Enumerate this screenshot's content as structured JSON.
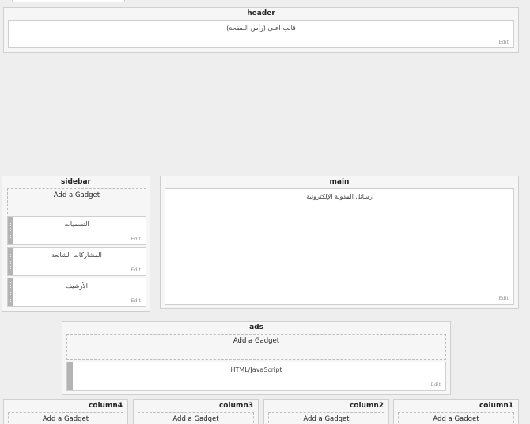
{
  "header": {
    "title": "header",
    "widget_title": "قالب اعلى (رأس الصفحة)",
    "edit": "Edit"
  },
  "sidebar": {
    "title": "sidebar",
    "add_gadget": "Add a Gadget",
    "widgets": [
      {
        "title": "التسميات",
        "edit": "Edit"
      },
      {
        "title": "المشاركات الشائعة",
        "edit": "Edit"
      },
      {
        "title": "الأرشيف",
        "edit": "Edit"
      }
    ]
  },
  "main": {
    "title": "main",
    "widget_title": "رسائل المدونة الإلكترونية",
    "edit": "Edit"
  },
  "ads": {
    "title": "ads",
    "add_gadget": "Add a Gadget",
    "widget_title": "HTML/JavaScript",
    "edit": "Edit"
  },
  "columns": [
    {
      "title": "column4",
      "add_gadget": "Add a Gadget"
    },
    {
      "title": "column3",
      "add_gadget": "Add a Gadget"
    },
    {
      "title": "column2",
      "add_gadget": "Add a Gadget"
    },
    {
      "title": "column1",
      "add_gadget": "Add a Gadget"
    }
  ]
}
